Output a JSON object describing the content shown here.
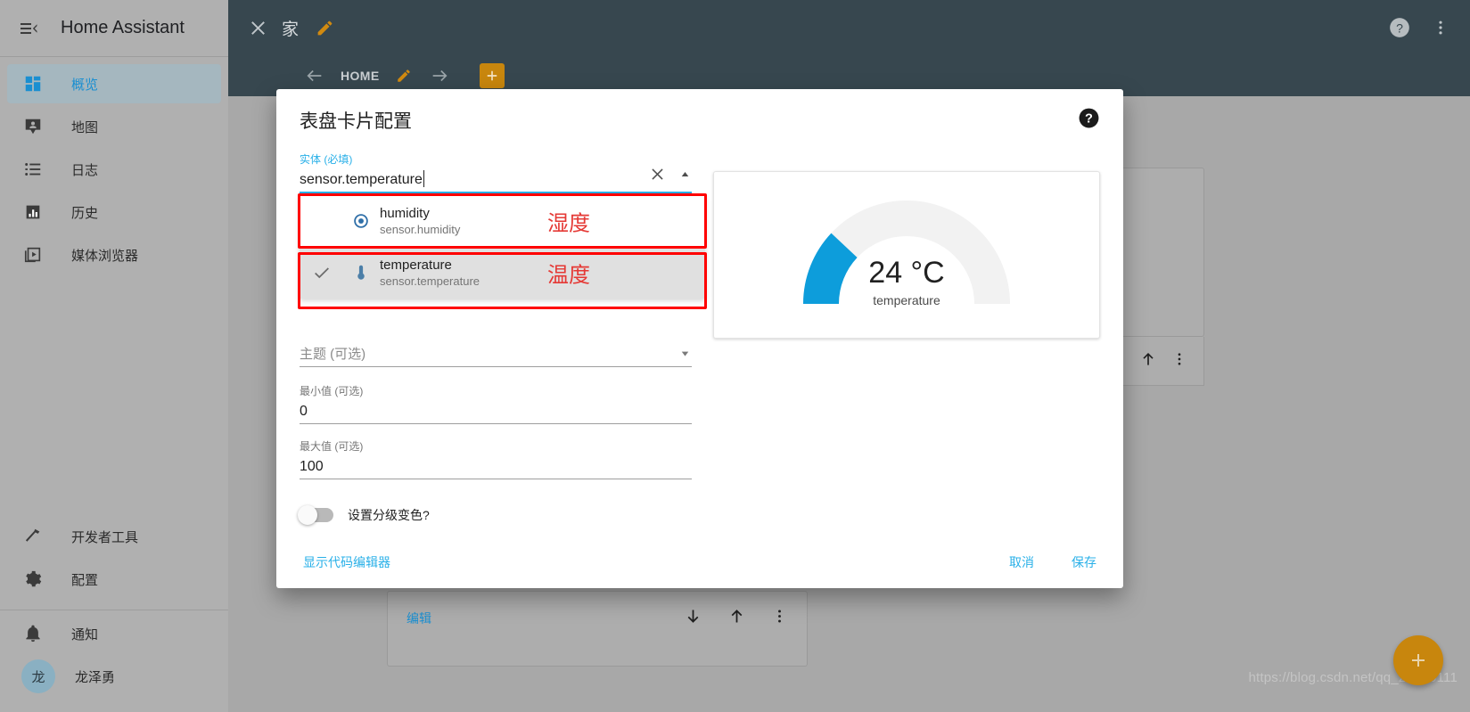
{
  "sidebar": {
    "app_title": "Home Assistant",
    "menu_icon": "menu-collapse-icon",
    "items": [
      {
        "label": "概览",
        "icon": "view-dashboard-icon",
        "active": true
      },
      {
        "label": "地图",
        "icon": "map-marker-icon",
        "active": false
      },
      {
        "label": "日志",
        "icon": "format-list-bulleted-icon",
        "active": false
      },
      {
        "label": "历史",
        "icon": "chart-box-icon",
        "active": false
      },
      {
        "label": "媒体浏览器",
        "icon": "play-box-multiple-icon",
        "active": false
      }
    ],
    "tools": [
      {
        "label": "开发者工具",
        "icon": "hammer-wrench-icon"
      },
      {
        "label": "配置",
        "icon": "cog-icon"
      }
    ],
    "bottom": [
      {
        "label": "通知",
        "icon": "bell-icon"
      }
    ],
    "user": {
      "label": "龙泽勇",
      "initial": "龙"
    }
  },
  "topbar": {
    "close_icon": "close-icon",
    "title": "家",
    "edit_icon": "pencil-icon",
    "help_icon": "help-circle-icon",
    "overflow_icon": "dots-vertical-icon"
  },
  "tabbar": {
    "prev_icon": "arrow-left-icon",
    "tab_label": "HOME",
    "tab_edit_icon": "pencil-icon",
    "next_icon": "arrow-right-icon",
    "add_icon": "plus-icon"
  },
  "background": {
    "edit_link": "编辑",
    "move_down_icon": "arrow-down-icon",
    "move_up_icon": "arrow-up-icon",
    "more_icon": "dots-vertical-icon",
    "fab_icon": "plus-icon",
    "watermark": "https://blog.csdn.net/qq_25886111"
  },
  "dialog": {
    "title": "表盘卡片配置",
    "help_icon": "help-circle-icon",
    "entity_field": {
      "label": "实体 (必填)",
      "value": "sensor.temperature",
      "clear_icon": "close-icon",
      "collapse_icon": "menu-up-icon"
    },
    "entity_options": [
      {
        "name": "humidity",
        "id": "sensor.humidity",
        "icon": "water-percent-icon",
        "note": "湿度",
        "selected": false,
        "highlighted": true
      },
      {
        "name": "temperature",
        "id": "sensor.temperature",
        "icon": "thermometer-icon",
        "note": "温度",
        "selected": true,
        "highlighted": true
      }
    ],
    "theme_field": {
      "label": "主题 (可选)",
      "value": "",
      "dropdown_icon": "menu-down-icon"
    },
    "min_field": {
      "label": "最小值 (可选)",
      "value": "0"
    },
    "max_field": {
      "label": "最大值 (可选)",
      "value": "100"
    },
    "severity_toggle": {
      "label": "设置分级变色?",
      "on": false
    },
    "footer": {
      "code_editor": "显示代码编辑器",
      "cancel": "取消",
      "save": "保存"
    }
  },
  "preview": {
    "gauge_value": "24 °C",
    "gauge_name": "temperature"
  },
  "chart_data": {
    "type": "gauge",
    "title": "temperature",
    "value": 24,
    "unit": "°C",
    "min": 0,
    "max": 100,
    "percent": 24,
    "arc_color": "#0d9ddb",
    "track_color": "#f2f2f2",
    "label": "24 °C"
  },
  "colors": {
    "accent_blue": "#29b0e8",
    "orange": "#c8860d",
    "highlight_red": "#ff0000",
    "gauge_blue": "#0d9ddb",
    "topbar": "#37474f"
  }
}
